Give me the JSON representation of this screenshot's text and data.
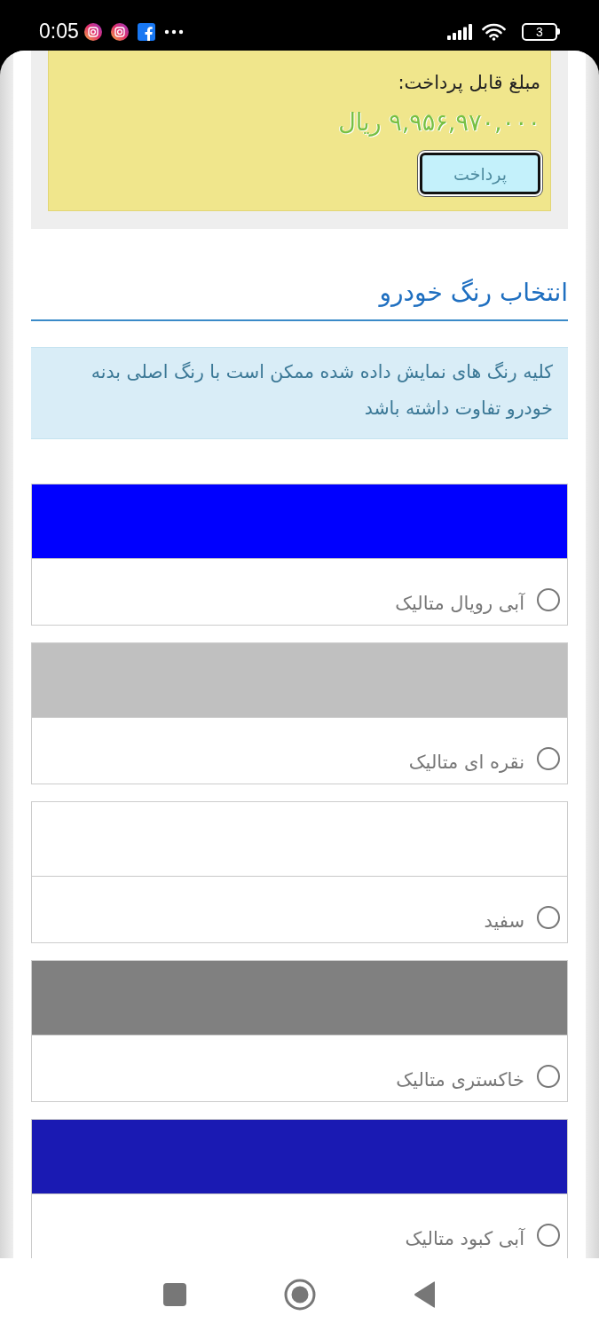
{
  "status_bar": {
    "time": "0:05",
    "battery": "3"
  },
  "payment": {
    "label": "مبلغ قابل پرداخت:",
    "amount": "۹,۹۵۶,۹۷۰,۰۰۰ ریال",
    "button": "پرداخت"
  },
  "section": {
    "title": "انتخاب رنگ خودرو",
    "notice": "کلیه رنگ های نمایش داده شده ممکن است با رنگ اصلی بدنه خودرو تفاوت داشته باشد"
  },
  "colors": [
    {
      "name": "آبی رویال متالیک",
      "color": "#0000ff",
      "selected": false
    },
    {
      "name": "نقره ای متالیک",
      "color": "#c0c0c0",
      "selected": false
    },
    {
      "name": "سفید",
      "color": "#ffffff",
      "selected": false
    },
    {
      "name": "خاکستری متالیک",
      "color": "#808080",
      "selected": false
    },
    {
      "name": "آبی کبود متالیک",
      "color": "#1a1ab3",
      "selected": false
    }
  ]
}
